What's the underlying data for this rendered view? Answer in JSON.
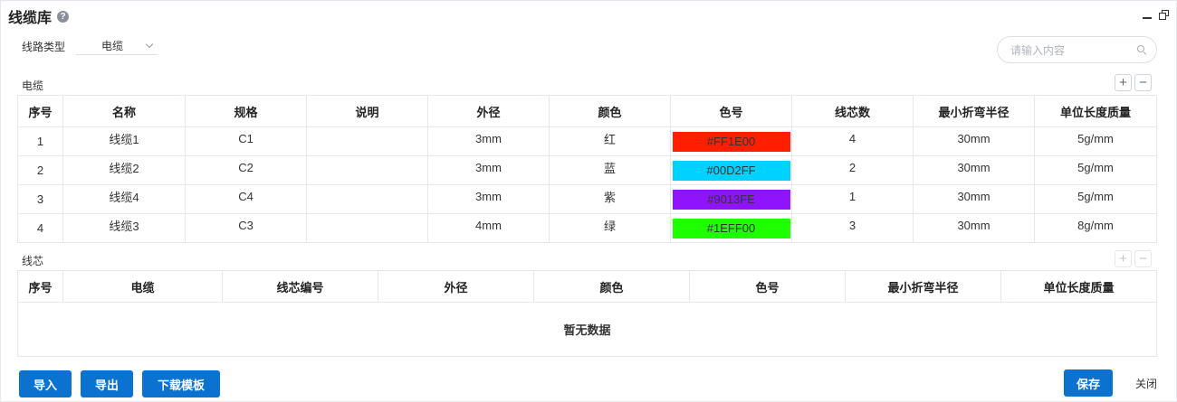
{
  "header": {
    "title": "线缆库",
    "help_icon": "?"
  },
  "filter": {
    "label": "线路类型",
    "selected": "电缆"
  },
  "search": {
    "placeholder": "请输入内容"
  },
  "cable_section": {
    "label": "电缆",
    "columns": [
      "序号",
      "名称",
      "规格",
      "说明",
      "外径",
      "颜色",
      "色号",
      "线芯数",
      "最小折弯半径",
      "单位长度质量"
    ],
    "rows": [
      {
        "index": "1",
        "name": "线缆1",
        "spec": "C1",
        "desc": "",
        "diameter": "3mm",
        "color": "红",
        "code": "#FF1E00",
        "swatch": "#FF1E00",
        "cores": "4",
        "radius": "30mm",
        "mass": "5g/mm"
      },
      {
        "index": "2",
        "name": "线缆2",
        "spec": "C2",
        "desc": "",
        "diameter": "3mm",
        "color": "蓝",
        "code": "#00D2FF",
        "swatch": "#00D2FF",
        "cores": "2",
        "radius": "30mm",
        "mass": "5g/mm"
      },
      {
        "index": "3",
        "name": "线缆4",
        "spec": "C4",
        "desc": "",
        "diameter": "3mm",
        "color": "紫",
        "code": "#9013FE",
        "swatch": "#9013FE",
        "cores": "1",
        "radius": "30mm",
        "mass": "5g/mm"
      },
      {
        "index": "4",
        "name": "线缆3",
        "spec": "C3",
        "desc": "",
        "diameter": "4mm",
        "color": "绿",
        "code": "#1EFF00",
        "swatch": "#1EFF00",
        "cores": "3",
        "radius": "30mm",
        "mass": "8g/mm"
      }
    ]
  },
  "core_section": {
    "label": "线芯",
    "columns": [
      "序号",
      "电缆",
      "线芯编号",
      "外径",
      "颜色",
      "色号",
      "最小折弯半径",
      "单位长度质量"
    ],
    "empty_text": "暂无数据"
  },
  "toolbar": {
    "plus": "+",
    "minus": "−"
  },
  "footer": {
    "import_label": "导入",
    "export_label": "导出",
    "template_label": "下载模板",
    "save_label": "保存",
    "close_label": "关闭"
  },
  "colors": {
    "primary": "#0B72CF",
    "border": "#E4E7ED"
  }
}
